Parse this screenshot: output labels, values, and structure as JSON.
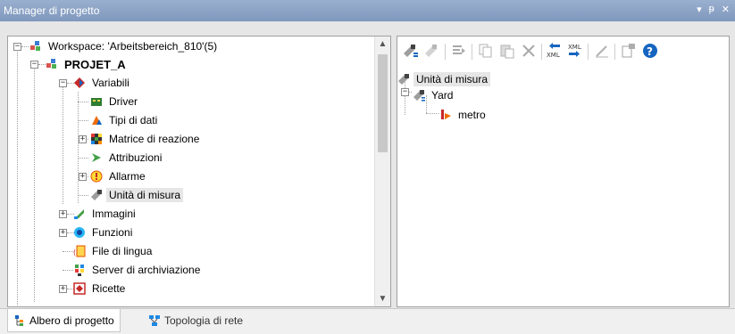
{
  "window": {
    "title": "Manager di progetto",
    "controls": [
      "▾",
      "ᵽ",
      "✕"
    ]
  },
  "tree": {
    "workspace_label": "Workspace: 'Arbeitsbereich_810'(5)",
    "project_label": "PROJET_A",
    "items": {
      "variabili": "Variabili",
      "driver": "Driver",
      "tipi_dati": "Tipi di dati",
      "matrice": "Matrice di reazione",
      "attribuzioni": "Attribuzioni",
      "allarme": "Allarme",
      "unita": "Unità di misura",
      "immagini": "Immagini",
      "funzioni": "Funzioni",
      "file_lingua": "File di lingua",
      "server_arch": "Server di archiviazione",
      "ricette": "Ricette"
    },
    "selected": "Unità di misura"
  },
  "detail": {
    "root_label": "Unità di misura",
    "yard_label": "Yard",
    "metro_label": "metro"
  },
  "tabs": {
    "albero": "Albero di progetto",
    "topologia": "Topologia di rete"
  }
}
